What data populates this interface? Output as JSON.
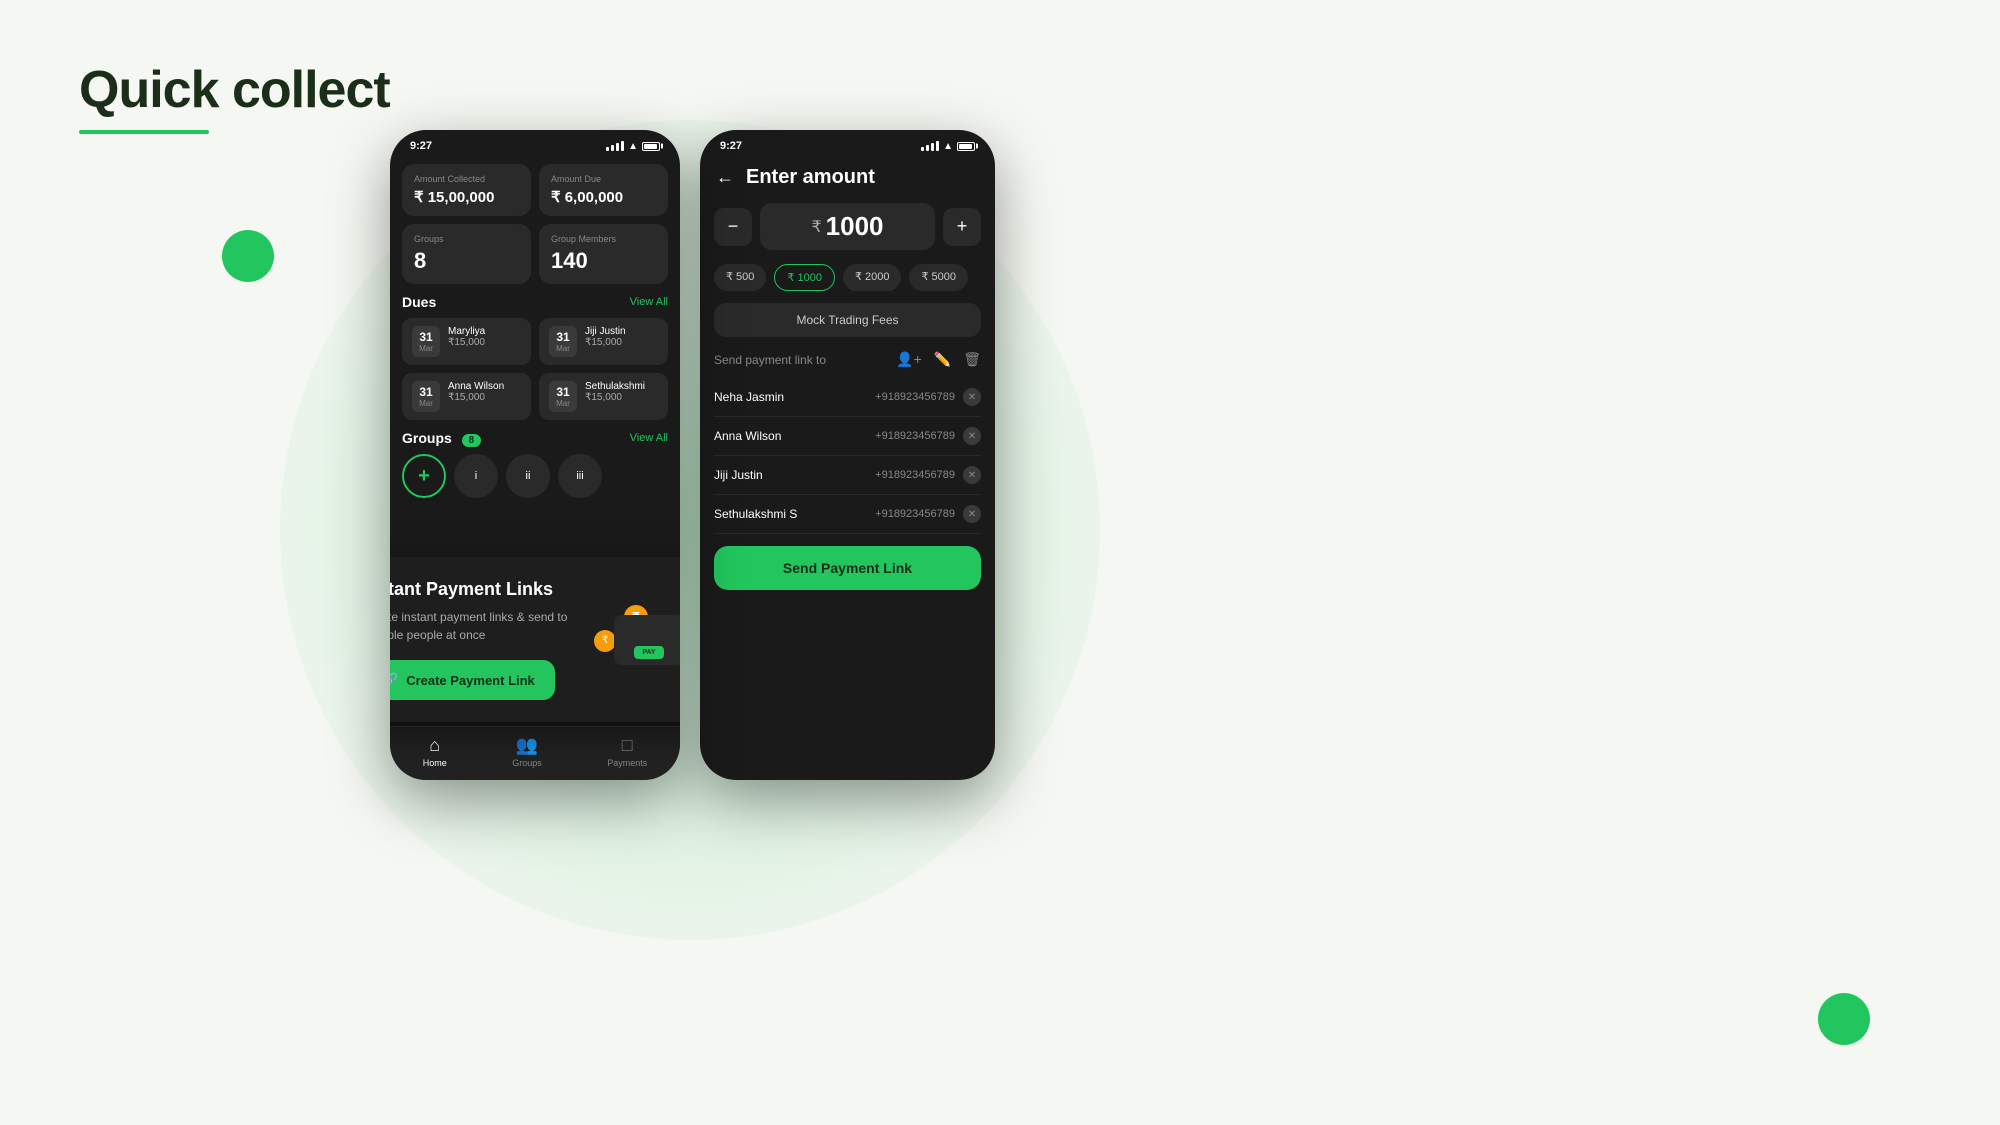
{
  "page": {
    "title": "Quick collect",
    "title_underline_color": "#22c55e",
    "bg_color": "#f5f7f2"
  },
  "phone1": {
    "status_time": "9:27",
    "stats": {
      "amount_collected_label": "Amount Collected",
      "amount_collected_value": "₹ 15,00,000",
      "amount_due_label": "Amount Due",
      "amount_due_value": "₹ 6,00,000",
      "groups_label": "Groups",
      "groups_value": "8",
      "group_members_label": "Group Members",
      "group_members_value": "140"
    },
    "dues": {
      "title": "Dues",
      "view_all": "View All",
      "items": [
        {
          "day": "31",
          "month": "Mar",
          "name": "Maryliya",
          "amount": "₹15,000"
        },
        {
          "day": "31",
          "month": "Mar",
          "name": "Jiji Justin",
          "amount": "₹15,000"
        },
        {
          "day": "31",
          "month": "Mar",
          "name": "Anna Wilson",
          "amount": "₹15,000"
        },
        {
          "day": "31",
          "month": "Mar",
          "name": "Sethulakshmi",
          "amount": "₹15,000"
        }
      ]
    },
    "groups": {
      "title": "Groups",
      "count": "8",
      "view_all": "View All",
      "items": [
        "i",
        "ii",
        "iii"
      ]
    },
    "nav": {
      "home_label": "Home",
      "groups_label": "Groups",
      "payments_label": "Payments"
    }
  },
  "payment_overlay": {
    "title": "Instant Payment Links",
    "description": "Create instant payment links & send to multiple people at once",
    "button_label": "Create Payment Link"
  },
  "phone2": {
    "status_time": "9:27",
    "header": {
      "back_label": "←",
      "title": "Enter amount"
    },
    "amount": {
      "minus_label": "−",
      "plus_label": "+",
      "currency": "₹",
      "value": "1000"
    },
    "quick_amounts": [
      {
        "label": "₹ 500",
        "active": false
      },
      {
        "label": "₹ 1000",
        "active": true
      },
      {
        "label": "₹ 2000",
        "active": false
      },
      {
        "label": "₹ 5000",
        "active": false
      }
    ],
    "mock_fees_label": "Mock Trading Fees",
    "send_link_title": "Send payment link to",
    "contacts": [
      {
        "name": "Neha Jasmin",
        "phone": "+918923456789"
      },
      {
        "name": "Anna Wilson",
        "phone": "+918923456789"
      },
      {
        "name": "Jiji Justin",
        "phone": "+918923456789"
      },
      {
        "name": "Sethulakshmi S",
        "phone": "+918923456789"
      }
    ],
    "send_button_label": "Send Payment Link"
  }
}
